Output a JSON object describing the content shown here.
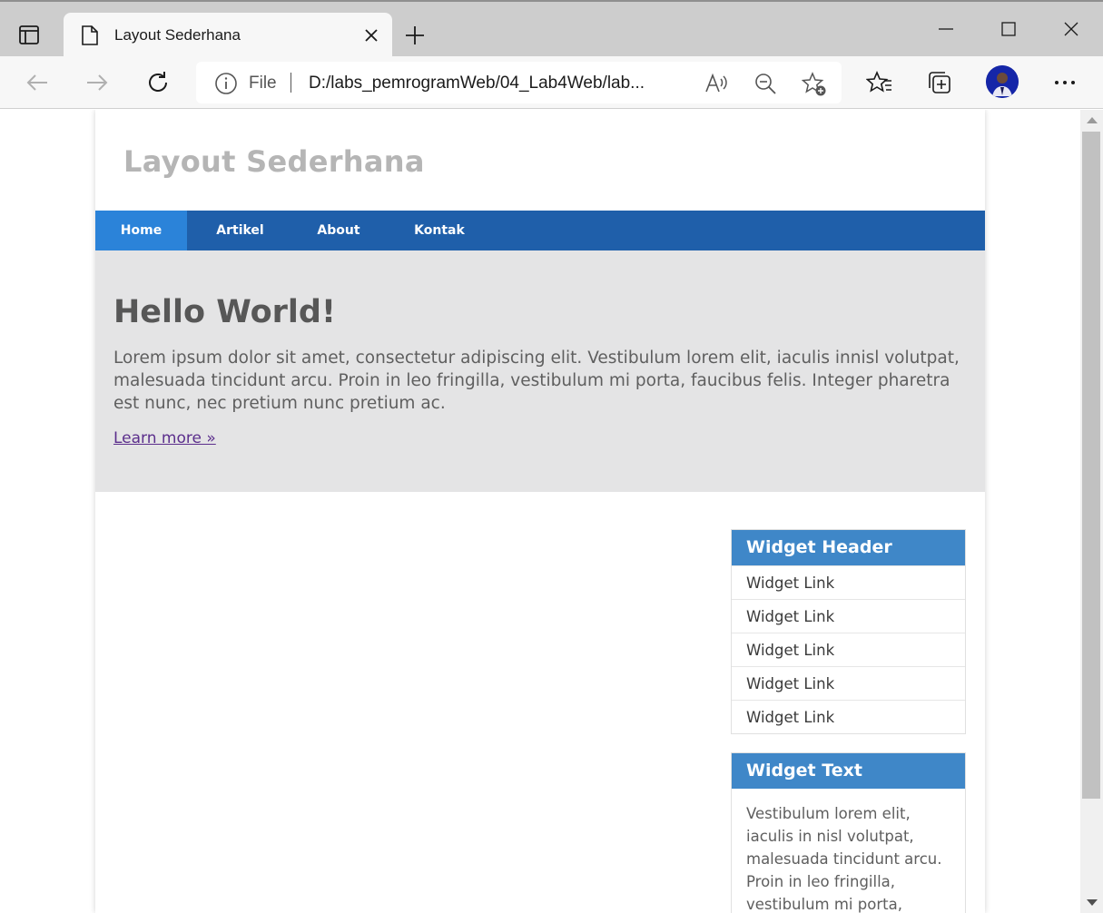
{
  "browser": {
    "tab_title": "Layout Sederhana",
    "address_scheme": "File",
    "address_url": "D:/labs_pemrogramWeb/04_Lab4Web/lab..."
  },
  "site": {
    "title": "Layout Sederhana",
    "nav": [
      {
        "label": "Home",
        "active": true
      },
      {
        "label": "Artikel",
        "active": false
      },
      {
        "label": "About",
        "active": false
      },
      {
        "label": "Kontak",
        "active": false
      }
    ],
    "hero": {
      "title": "Hello World!",
      "text": "Lorem ipsum dolor sit amet, consectetur adipiscing elit. Vestibulum lorem elit, iaculis innisl volutpat, malesuada tincidunt arcu. Proin in leo fringilla, vestibulum mi porta, faucibus felis. Integer pharetra est nunc, nec pretium nunc pretium ac.",
      "link": "Learn more »"
    },
    "widget_links": {
      "header": "Widget Header",
      "links": [
        "Widget Link",
        "Widget Link",
        "Widget Link",
        "Widget Link",
        "Widget Link"
      ]
    },
    "widget_text": {
      "header": "Widget Text",
      "text": "Vestibulum lorem elit, iaculis in nisl volutpat, malesuada tincidunt arcu. Proin in leo fringilla, vestibulum mi porta, faucibus felis. Integer"
    }
  },
  "colors": {
    "nav_bg": "#1f5faa",
    "nav_active": "#2b83d9",
    "widget_header": "#3f87c8",
    "hero_bg": "#e4e4e5"
  }
}
